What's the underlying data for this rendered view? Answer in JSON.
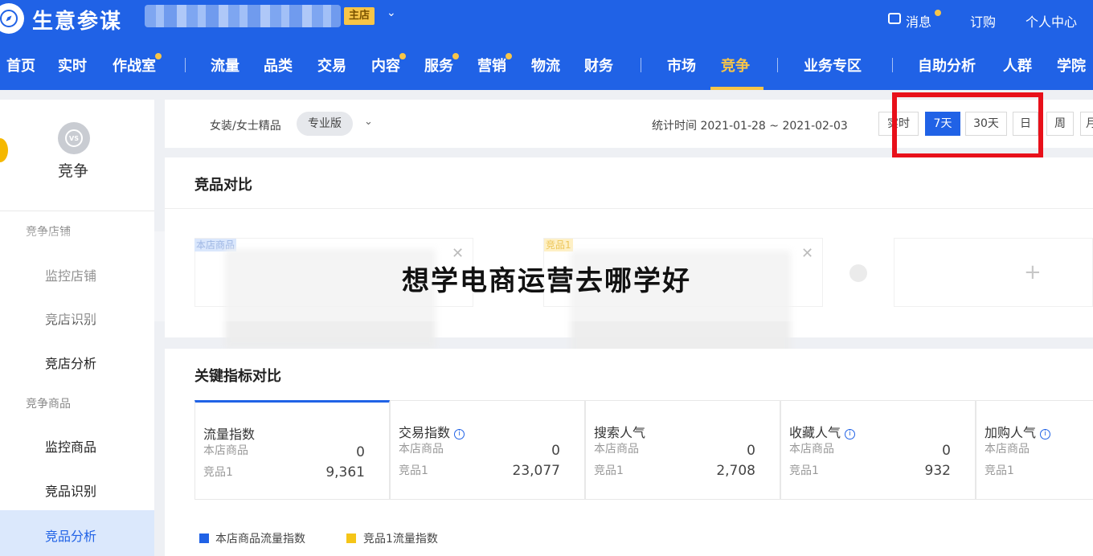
{
  "header": {
    "app_title": "生意参谋",
    "shop_badge": "主店",
    "right_links": [
      "消息",
      "订购",
      "个人中心"
    ]
  },
  "nav": {
    "items": [
      "首页",
      "实时",
      "作战室",
      "流量",
      "品类",
      "交易",
      "内容",
      "服务",
      "营销",
      "物流",
      "财务",
      "市场",
      "竞争",
      "业务专区",
      "自助分析",
      "人群",
      "学院"
    ],
    "active": "竞争"
  },
  "sidebar": {
    "title": "竞争",
    "group_shop": "竞争店铺",
    "shop_links": [
      "监控店铺",
      "竞店识别",
      "竞店分析"
    ],
    "group_goods": "竞争商品",
    "goods_links": [
      "监控商品",
      "竞品识别"
    ],
    "active_item": "竞品分析"
  },
  "filter": {
    "category": "女装/女士精品",
    "edition": "专业版",
    "stat_time": "统计时间 2021-01-28 ~ 2021-02-03",
    "time_buttons": [
      "实时",
      "7天",
      "30天",
      "日",
      "周",
      "月"
    ],
    "active_time": "7天"
  },
  "compare": {
    "title": "竞品对比",
    "tag_own": "本店商品",
    "tag_rival": "竞品1",
    "add_symbol": "+"
  },
  "watermark": "想学电商运营去哪学好",
  "metrics": {
    "title": "关键指标对比",
    "row_own": "本店商品",
    "row_rival": "竞品1",
    "items": [
      {
        "name": "流量指数",
        "own": "0",
        "rival": "9,361"
      },
      {
        "name": "交易指数",
        "own": "0",
        "rival": "23,077"
      },
      {
        "name": "搜索人气",
        "own": "0",
        "rival": "2,708"
      },
      {
        "name": "收藏人气",
        "own": "0",
        "rival": "932"
      },
      {
        "name": "加购人气",
        "own": "",
        "rival": ""
      }
    ],
    "legend": [
      "本店商品流量指数",
      "竞品1流量指数"
    ]
  },
  "colors": {
    "brand": "#2062e6",
    "accent": "#f7c548",
    "highlight": "#e8101a",
    "own_series": "#2062e6",
    "rival_series": "#f5c518"
  }
}
